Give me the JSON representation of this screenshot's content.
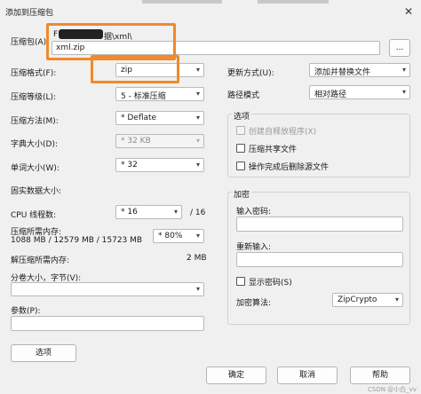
{
  "window": {
    "title": "添加到压缩包",
    "close_glyph": "✕"
  },
  "archive": {
    "label": "压缩包(A):",
    "path_start": "F",
    "path_end": "据\\xml\\",
    "filename": "xml.zip",
    "browse_label": "..."
  },
  "left": {
    "format": {
      "label": "压缩格式(F):",
      "value": "zip"
    },
    "level": {
      "label": "压缩等级(L):",
      "value": "5 - 标准压缩"
    },
    "method": {
      "label": "压缩方法(M):",
      "value": "* Deflate"
    },
    "dict": {
      "label": "字典大小(D):",
      "value": "* 32 KB"
    },
    "word": {
      "label": "单词大小(W):",
      "value": "* 32"
    },
    "solid": {
      "label": "固实数据大小:"
    },
    "threads": {
      "label": "CPU 线程数:",
      "value": "* 16",
      "max": "/ 16"
    },
    "memory": {
      "label": "压缩所需内存:",
      "value": "1088 MB / 12579 MB / 15723 MB",
      "percent": "* 80%"
    },
    "decomp": {
      "label": "解压缩所需内存:",
      "value": "2 MB"
    },
    "split": {
      "label": "分卷大小，字节(V):"
    },
    "params": {
      "label": "参数(P):"
    },
    "options_button": "选项"
  },
  "right": {
    "update": {
      "label": "更新方式(U):",
      "value": "添加并替换文件"
    },
    "pathmode": {
      "label": "路径模式",
      "value": "相对路径"
    },
    "options": {
      "title": "选项",
      "sfx": "创建自释放程序(X)",
      "shared": "压缩共享文件",
      "delete_after": "操作完成后删除源文件"
    },
    "encryption": {
      "title": "加密",
      "password_label": "输入密码:",
      "reenter_label": "重新输入:",
      "show_password": "显示密码(S)",
      "method_label": "加密算法:",
      "method_value": "ZipCrypto"
    }
  },
  "buttons": {
    "ok": "确定",
    "cancel": "取消",
    "help": "帮助"
  },
  "watermark": "CSDN @小白_vv",
  "icons": {
    "dropdown": "chevron-down-icon"
  },
  "colors": {
    "highlight": "#f08a2a"
  }
}
